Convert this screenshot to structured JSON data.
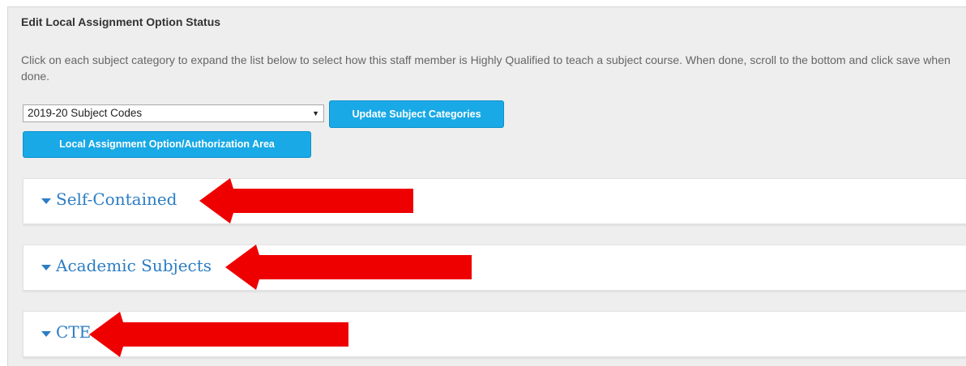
{
  "header": {
    "title": "Edit Local Assignment Option Status",
    "description": "Click on each subject category to expand the list below to select how this staff member is Highly Qualified to teach a subject course. When done, scroll to the bottom and click save when done."
  },
  "controls": {
    "subject_codes_select": "2019-20 Subject Codes",
    "update_button": "Update Subject Categories",
    "local_assignment_button": "Local Assignment Option/Authorization Area"
  },
  "sections": [
    {
      "label": "Self-Contained"
    },
    {
      "label": "Academic Subjects"
    },
    {
      "label": "CTE"
    }
  ],
  "colors": {
    "accent_button": "#19a9e6",
    "section_text": "#2c7dc3",
    "annotation_arrow": "#ee0000"
  },
  "icons": {
    "section_toggle": "caret-down-icon",
    "select_toggle": "dropdown-arrow-icon",
    "annotation": "red-arrow-icon"
  }
}
